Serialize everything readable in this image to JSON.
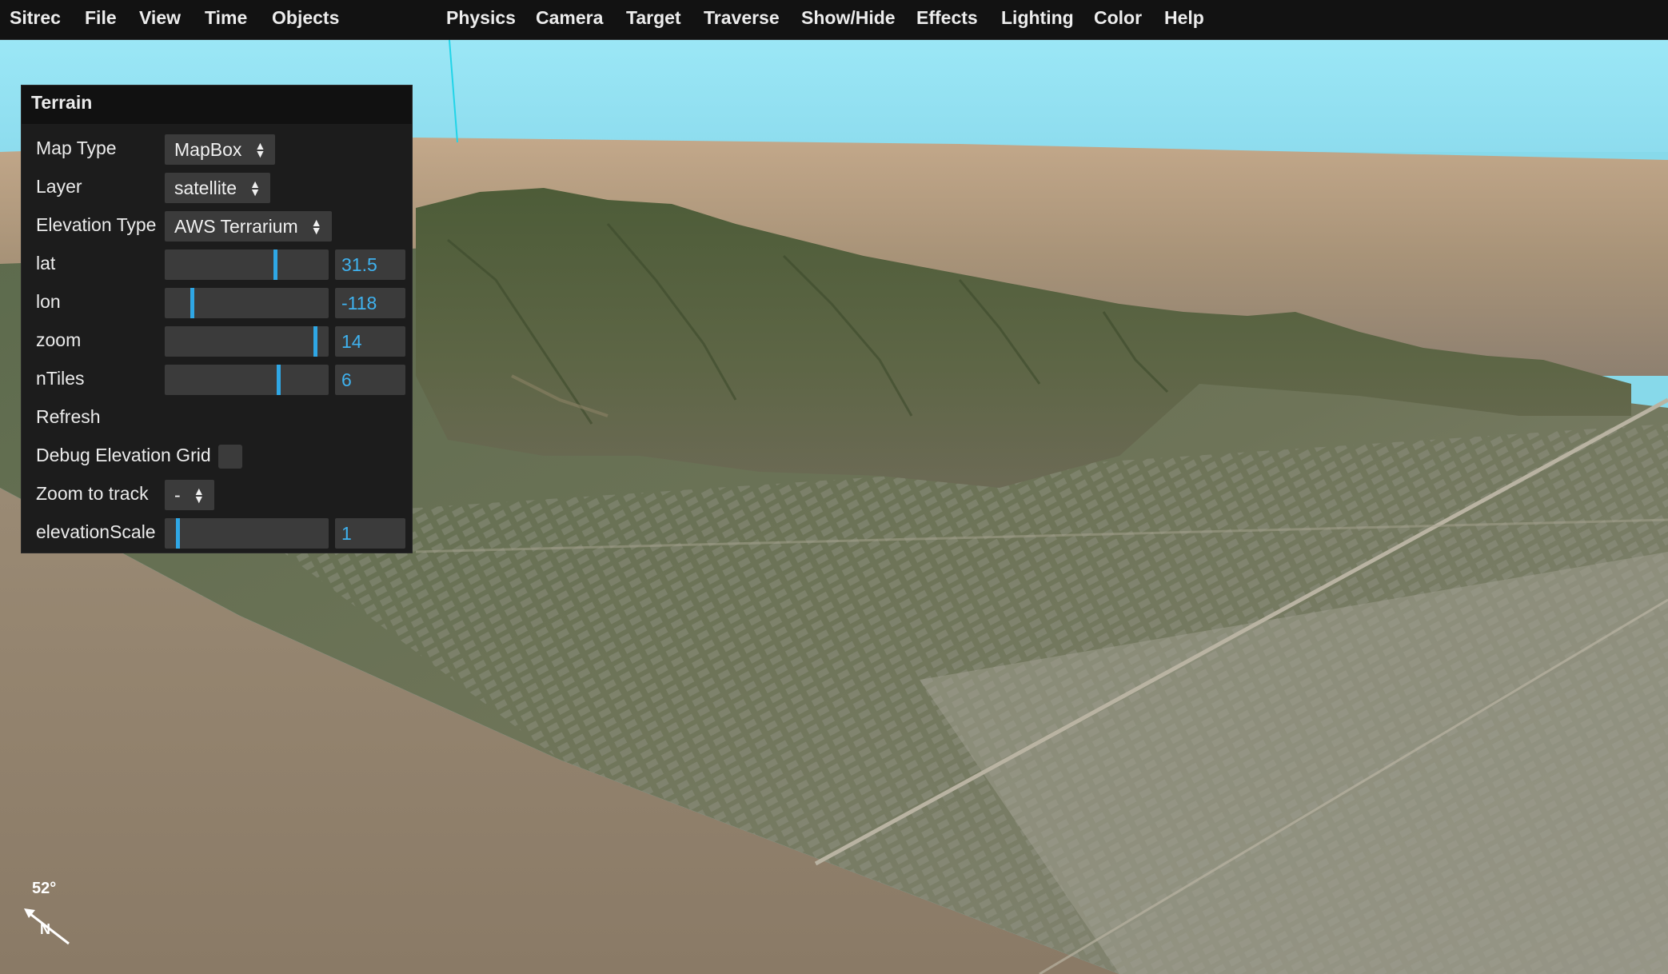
{
  "menubar": {
    "items": [
      "Sitrec",
      "File",
      "View",
      "Time",
      "Objects",
      "Physics",
      "Camera",
      "Target",
      "Traverse",
      "Show/Hide",
      "Effects",
      "Lighting",
      "Color",
      "Help"
    ]
  },
  "panel": {
    "title": "Terrain",
    "map_type": {
      "label": "Map Type",
      "value": "MapBox"
    },
    "layer": {
      "label": "Layer",
      "value": "satellite"
    },
    "elevation_type": {
      "label": "Elevation Type",
      "value": "AWS Terrarium"
    },
    "lat": {
      "label": "lat",
      "value": "31.5",
      "fraction": 0.68
    },
    "lon": {
      "label": "lon",
      "value": "-118",
      "fraction": 0.16
    },
    "zoom": {
      "label": "zoom",
      "value": "14",
      "fraction": 0.93
    },
    "ntiles": {
      "label": "nTiles",
      "value": "6",
      "fraction": 0.7
    },
    "refresh": {
      "label": "Refresh"
    },
    "debug_grid": {
      "label": "Debug Elevation Grid",
      "checked": false
    },
    "zoom_to_track": {
      "label": "Zoom to track",
      "value": "-"
    },
    "elevation_scale": {
      "label": "elevationScale",
      "value": "1",
      "fraction": 0.07
    }
  },
  "compass": {
    "angle": "52°",
    "north": "N"
  },
  "colors": {
    "sky": "#8fe3f4",
    "accent": "#2fa7e5",
    "menubar": "#121212",
    "panel": "#1c1c1c"
  }
}
